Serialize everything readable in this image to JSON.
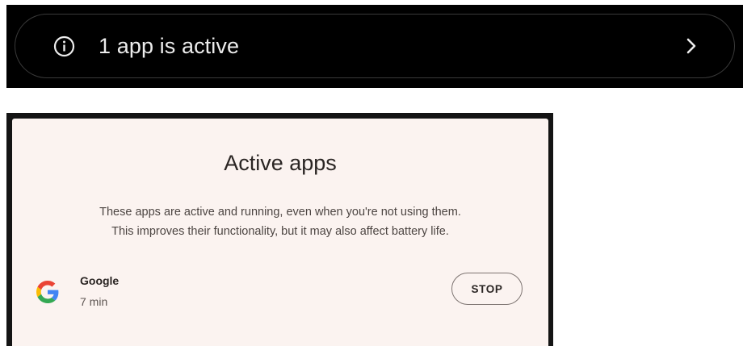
{
  "banner": {
    "icon": "info-circle-icon",
    "text": "1 app is active",
    "chevron_icon": "chevron-right-icon",
    "text_color": "#ececec",
    "background": "#000000"
  },
  "dialog": {
    "title": "Active apps",
    "description_lines": [
      "These apps are active and running, even when you're not using them.",
      "This improves their functionality, but it may also affect battery life."
    ],
    "background": "#fbf3f0",
    "apps": [
      {
        "icon": "google-g-icon",
        "name": "Google",
        "duration": "7 min",
        "action_label": "STOP"
      }
    ]
  }
}
